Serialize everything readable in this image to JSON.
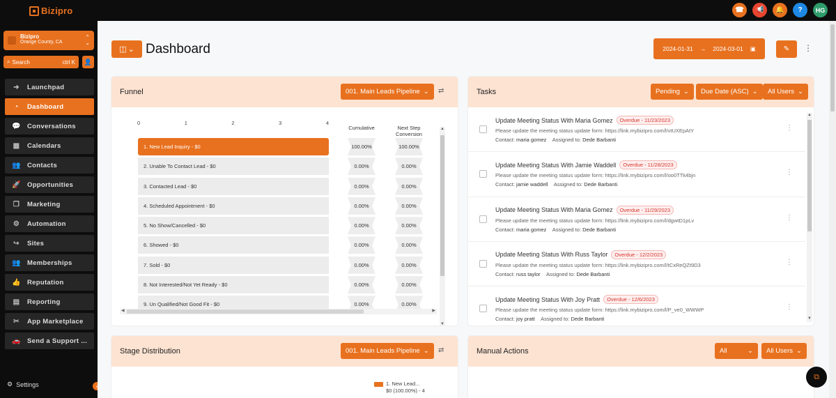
{
  "brand": {
    "logo_text": "Bizipro"
  },
  "topbar": {
    "icons": [
      {
        "name": "phone-icon",
        "glyph": "☎"
      },
      {
        "name": "megaphone-icon",
        "glyph": "📢"
      },
      {
        "name": "bell-icon",
        "glyph": "🔔"
      },
      {
        "name": "help-icon",
        "glyph": "?"
      }
    ],
    "avatar_initials": "HG"
  },
  "sidebar": {
    "account": {
      "name": "Bizipro",
      "location": "Orange County, CA"
    },
    "search": {
      "label": "Search",
      "shortcut": "ctrl K"
    },
    "items": [
      {
        "label": "Launchpad",
        "icon": "rocket-launch-icon",
        "glyph": "➜",
        "active": false
      },
      {
        "label": "Dashboard",
        "icon": "dashboard-gauge-icon",
        "glyph": "◔",
        "active": true
      },
      {
        "label": "Conversations",
        "icon": "chat-bubble-icon",
        "glyph": "💬",
        "active": false
      },
      {
        "label": "Calendars",
        "icon": "calendar-icon",
        "glyph": "▦",
        "active": false
      },
      {
        "label": "Contacts",
        "icon": "contacts-icon",
        "glyph": "👥",
        "active": false
      },
      {
        "label": "Opportunities",
        "icon": "rocket-icon",
        "glyph": "🚀",
        "active": false
      },
      {
        "label": "Marketing",
        "icon": "marketing-icon",
        "glyph": "❐",
        "active": false
      },
      {
        "label": "Automation",
        "icon": "gear-icon",
        "glyph": "⚙",
        "active": false
      },
      {
        "label": "Sites",
        "icon": "share-icon",
        "glyph": "↪",
        "active": false
      },
      {
        "label": "Memberships",
        "icon": "memberships-icon",
        "glyph": "👥",
        "active": false
      },
      {
        "label": "Reputation",
        "icon": "thumbs-up-icon",
        "glyph": "👍",
        "active": false
      },
      {
        "label": "Reporting",
        "icon": "chart-icon",
        "glyph": "▤",
        "active": false
      },
      {
        "label": "App Marketplace",
        "icon": "marketplace-icon",
        "glyph": "✂",
        "active": false
      },
      {
        "label": "Send a Support ...",
        "icon": "support-car-icon",
        "glyph": "🚗",
        "active": false
      }
    ],
    "settings_label": "Settings"
  },
  "header": {
    "title": "Dashboard",
    "date_from": "2024-01-31",
    "date_to": "2024-03-01"
  },
  "funnel": {
    "title": "Funnel",
    "pipeline": "001. Main Leads Pipeline",
    "axis_ticks": [
      "0",
      "1",
      "2",
      "3",
      "4"
    ],
    "col_cumulative": "Cumulative",
    "col_next_step": "Next Step Conversion",
    "stages": [
      {
        "label": "1. New Lead Inquiry - $0",
        "cumulative": "100.00%",
        "next": "100.00%"
      },
      {
        "label": "2. Unable To Contact Lead - $0",
        "cumulative": "0.00%",
        "next": "0.00%"
      },
      {
        "label": "3. Contacted Lead - $0",
        "cumulative": "0.00%",
        "next": "0.00%"
      },
      {
        "label": "4. Scheduled Appointment - $0",
        "cumulative": "0.00%",
        "next": "0.00%"
      },
      {
        "label": "5. No Show/Cancelled - $0",
        "cumulative": "0.00%",
        "next": "0.00%"
      },
      {
        "label": "6. Showed - $0",
        "cumulative": "0.00%",
        "next": "0.00%"
      },
      {
        "label": "7. Sold - $0",
        "cumulative": "0.00%",
        "next": "0.00%"
      },
      {
        "label": "8. Not Interested/Not Yet Ready - $0",
        "cumulative": "0.00%",
        "next": "0.00%"
      },
      {
        "label": "9. Un Qualified/Not Good Fit - $0",
        "cumulative": "0.00%",
        "next": "0.00%"
      }
    ]
  },
  "tasks": {
    "title": "Tasks",
    "filter_status": "Pending",
    "filter_sort": "Due Date (ASC)",
    "filter_users": "All Users",
    "contact_label": "Contact:",
    "assigned_label": "Assigned to:",
    "desc_prefix": "Please update the meeting status update form:",
    "items": [
      {
        "title": "Update Meeting Status With Maria Gomez",
        "overdue": "Overdue - 11/23/2023",
        "link": "https://link.mybizipro.com/l/vtUXEpAtY",
        "contact": "maria gomez",
        "assignee": "Dede Barbanti"
      },
      {
        "title": "Update Meeting Status With Jamie Waddell",
        "overdue": "Overdue - 11/28/2023",
        "link": "https://link.mybizipro.com/l/oo0TTk4bjn",
        "contact": "jamie waddell",
        "assignee": "Dede Barbanti"
      },
      {
        "title": "Update Meeting Status With Maria Gomez",
        "overdue": "Overdue - 11/29/2023",
        "link": "https://link.mybizipro.com/l/dgwtD1pLv",
        "contact": "maria gomez",
        "assignee": "Dede Barbanti"
      },
      {
        "title": "Update Meeting Status With Russ Taylor",
        "overdue": "Overdue - 12/2/2023",
        "link": "https://link.mybizipro.com/l/tCxReQZt9D3",
        "contact": "russ taylor",
        "assignee": "Dede Barbanti"
      },
      {
        "title": "Update Meeting Status With Joy Pratt",
        "overdue": "Overdue - 12/6/2023",
        "link": "https://link.mybizipro.com/l/P_ve0_WWWP",
        "contact": "joy pratt",
        "assignee": "Dede Barbanti"
      }
    ]
  },
  "stage_distribution": {
    "title": "Stage Distribution",
    "pipeline": "001. Main Leads Pipeline",
    "legend_line1": "1. New Lead...",
    "legend_line2": "$0 (100.00%) - 4"
  },
  "manual_actions": {
    "title": "Manual Actions",
    "filter_type": "All",
    "filter_users": "All Users"
  },
  "colors": {
    "accent": "#e8711f",
    "card_header": "#fde3d2",
    "sidebar": "#0d0d0d"
  }
}
